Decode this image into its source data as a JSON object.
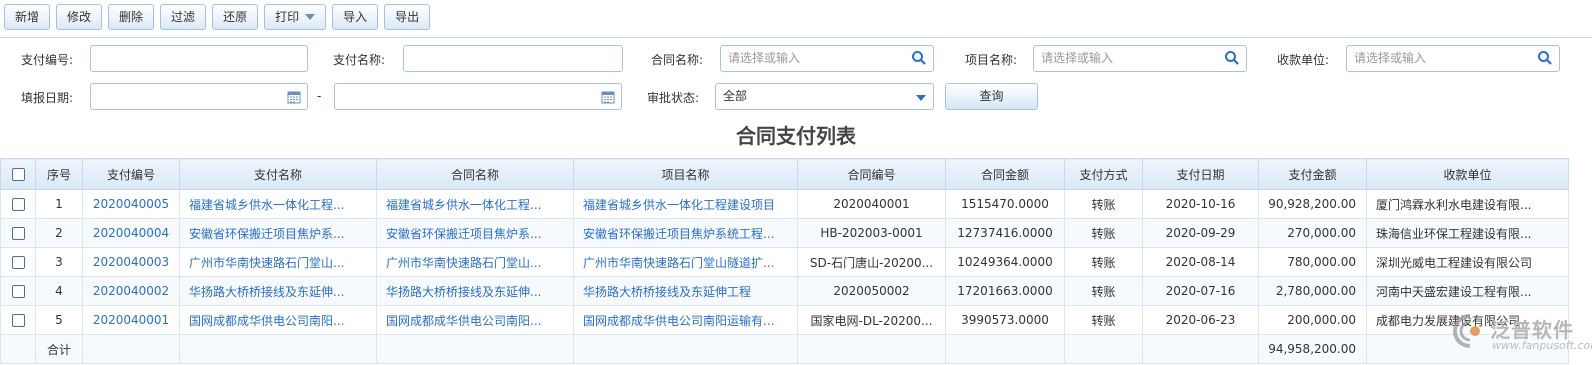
{
  "toolbar": {
    "add": "新增",
    "edit": "修改",
    "delete": "删除",
    "filter": "过滤",
    "restore": "还原",
    "print": "打印",
    "import": "导入",
    "export": "导出"
  },
  "filters": {
    "pay_no_label": "支付编号:",
    "pay_name_label": "支付名称:",
    "contract_name_label": "合同名称:",
    "contract_name_placeholder": "请选择或输入",
    "project_name_label": "项目名称:",
    "project_name_placeholder": "请选择或输入",
    "payee_label": "收款单位:",
    "payee_placeholder": "请选择或输入",
    "date_label": "填报日期:",
    "date_sep": "-",
    "status_label": "审批状态:",
    "status_value": "全部",
    "query": "查询"
  },
  "title": "合同支付列表",
  "table": {
    "headers": [
      "序号",
      "支付编号",
      "支付名称",
      "合同名称",
      "项目名称",
      "合同编号",
      "合同金额",
      "支付方式",
      "支付日期",
      "支付金额",
      "收款单位"
    ],
    "rows": [
      {
        "seq": "1",
        "pay_no": "2020040005",
        "pay_name": "福建省城乡供水一体化工程...",
        "contract": "福建省城乡供水一体化工程...",
        "project": "福建省城乡供水一体化工程建设项目",
        "contract_no": "2020040001",
        "contract_amount": "1515470.0000",
        "method": "转账",
        "date": "2020-10-16",
        "pay_amount": "90,928,200.00",
        "payee": "厦门鸿霖水利水电建设有限..."
      },
      {
        "seq": "2",
        "pay_no": "2020040004",
        "pay_name": "安徽省环保搬迁项目焦炉系...",
        "contract": "安徽省环保搬迁项目焦炉系...",
        "project": "安徽省环保搬迁项目焦炉系统工程...",
        "contract_no": "HB-202003-0001",
        "contract_amount": "12737416.0000",
        "method": "转账",
        "date": "2020-09-29",
        "pay_amount": "270,000.00",
        "payee": "珠海信业环保工程建设有限..."
      },
      {
        "seq": "3",
        "pay_no": "2020040003",
        "pay_name": "广州市华南快速路石门堂山...",
        "contract": "广州市华南快速路石门堂山...",
        "project": "广州市华南快速路石门堂山隧道扩...",
        "contract_no": "SD-石门唐山-20200...",
        "contract_amount": "10249364.0000",
        "method": "转账",
        "date": "2020-08-14",
        "pay_amount": "780,000.00",
        "payee": "深圳光威电工程建设有限公司"
      },
      {
        "seq": "4",
        "pay_no": "2020040002",
        "pay_name": "华扬路大桥桥接线及东延伸...",
        "contract": "华扬路大桥桥接线及东延伸...",
        "project": "华扬路大桥桥接线及东延伸工程",
        "contract_no": "2020050002",
        "contract_amount": "17201663.0000",
        "method": "转账",
        "date": "2020-07-16",
        "pay_amount": "2,780,000.00",
        "payee": "河南中天盛宏建设工程有限..."
      },
      {
        "seq": "5",
        "pay_no": "2020040001",
        "pay_name": "国网成都成华供电公司南阳...",
        "contract": "国网成都成华供电公司南阳...",
        "project": "国网成都成华供电公司南阳运输有...",
        "contract_no": "国家电网-DL-20200...",
        "contract_amount": "3990573.0000",
        "method": "转账",
        "date": "2020-06-23",
        "pay_amount": "200,000.00",
        "payee": "成都电力发展建设有限公司"
      }
    ],
    "total_label": "合计",
    "total_pay_amount": "94,958,200.00"
  },
  "watermark": {
    "brand": "泛普软件",
    "url": "www.fanpusoft.com"
  },
  "colors": {
    "link": "#2a6fc9",
    "border": "#a8c3e0",
    "header_bg": "#dae8f6"
  }
}
